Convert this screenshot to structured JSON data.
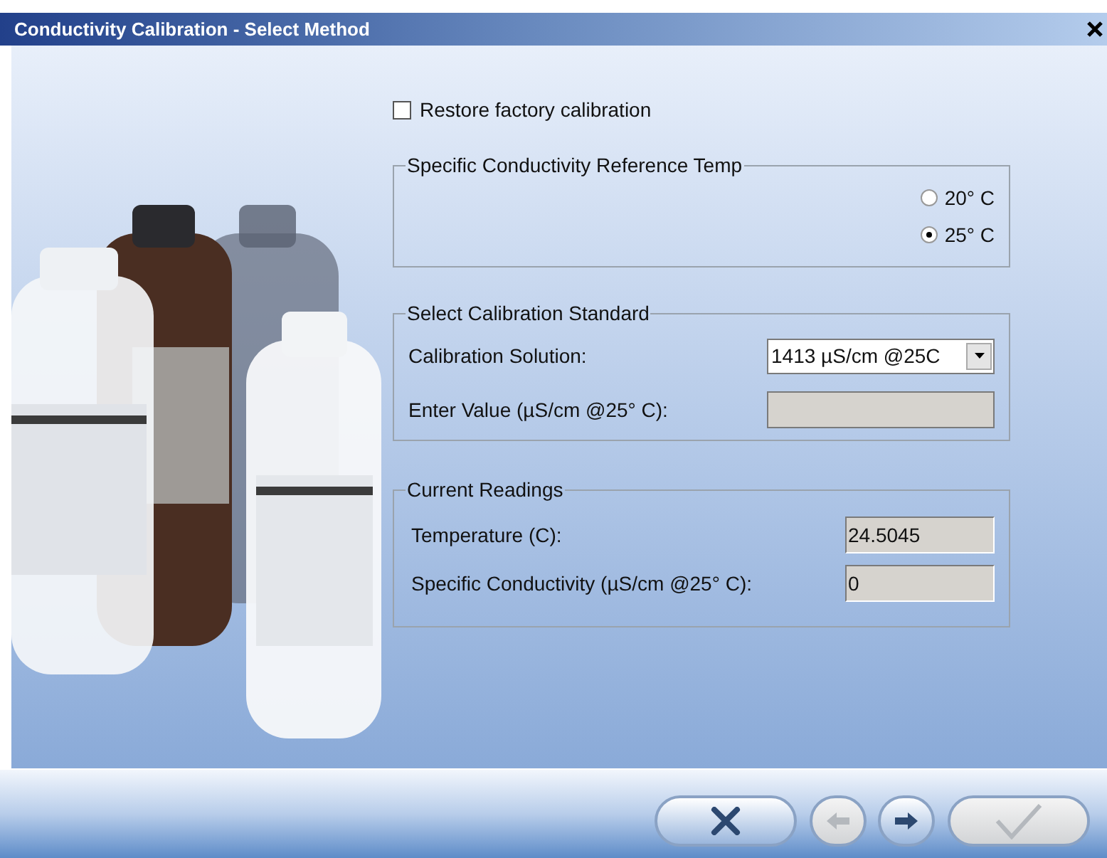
{
  "window": {
    "title": "Conductivity Calibration - Select Method"
  },
  "restore": {
    "label": "Restore factory calibration",
    "checked": false
  },
  "reference_temp": {
    "title": "Specific Conductivity Reference Temp",
    "options": [
      {
        "label": "20° C",
        "selected": false
      },
      {
        "label": "25° C",
        "selected": true
      }
    ]
  },
  "calibration_standard": {
    "title": "Select Calibration Standard",
    "solution_label": "Calibration Solution:",
    "solution_value": "1413 µS/cm @25C",
    "enter_label": "Enter Value (µS/cm @25° C):",
    "enter_disabled": true
  },
  "current_readings": {
    "title": "Current Readings",
    "fields": [
      {
        "label": "Temperature (C):",
        "value": "24.5045"
      },
      {
        "label": "Specific Conductivity (µS/cm @25° C):",
        "value": "0"
      }
    ]
  },
  "buttons": [
    {
      "kind": "cancel",
      "disabled": false
    },
    {
      "kind": "back",
      "disabled": true
    },
    {
      "kind": "next",
      "disabled": false
    },
    {
      "kind": "finish",
      "disabled": true
    }
  ]
}
